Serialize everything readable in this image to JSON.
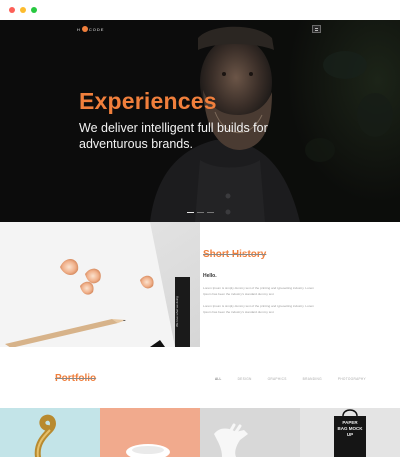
{
  "window": {
    "buttons": [
      {
        "name": "close",
        "color": "#fd5f57"
      },
      {
        "name": "minimize",
        "color": "#fdbc2e"
      },
      {
        "name": "maximize",
        "color": "#28c840"
      }
    ]
  },
  "header": {
    "logo_text": "CODE",
    "menu_icon": "hamburger-icon"
  },
  "hero": {
    "title": "Experiences",
    "subtitle": "We deliver intelligent full builds for adventurous brands.",
    "slides": 3,
    "active_slide": 1
  },
  "history": {
    "title": "Short History",
    "vertical_text": "We love what we doing",
    "hello": "Hello.",
    "paragraph_1": "Lorem Ipsum is simply dummy text of the printing and typesetting industry. Lorem Ipsum has been the industry's standard dummy text",
    "paragraph_2": "Lorem Ipsum is simply dummy text of the printing and typesetting industry. Lorem Ipsum has been the industry's standard dummy text"
  },
  "portfolio": {
    "title": "Portfolio",
    "filters": [
      "ALL",
      "DESIGN",
      "GRAPHICS",
      "BRANDING",
      "PHOTOGRAPHY"
    ],
    "active_filter": "ALL",
    "bag_text": "PAPER BAG MOCK UP"
  },
  "colors": {
    "accent": "#f07f3c",
    "dark": "#101010",
    "muted": "#999999"
  }
}
